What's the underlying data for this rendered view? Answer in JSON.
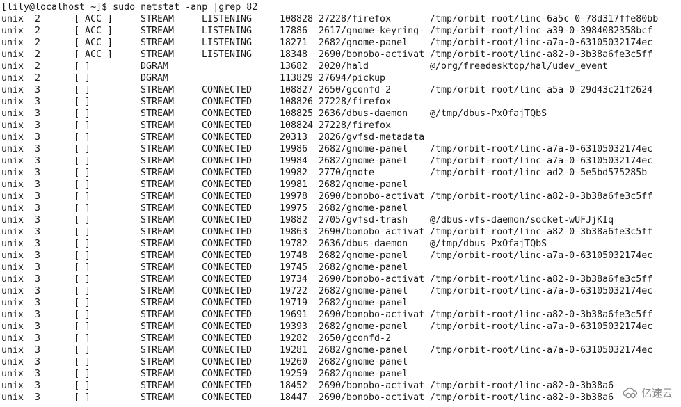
{
  "terminal": {
    "prompt": "[lily@localhost ~]$ sudo netstat -anp |grep 82",
    "rows": [
      {
        "proto": "unix",
        "refcnt": "2",
        "flags": "[ ACC ]",
        "type": "STREAM",
        "state": "LISTENING",
        "inode": "108828",
        "pid": "27228/firefox",
        "path": "/tmp/orbit-root/linc-6a5c-0-78d317ffe80bb"
      },
      {
        "proto": "unix",
        "refcnt": "2",
        "flags": "[ ACC ]",
        "type": "STREAM",
        "state": "LISTENING",
        "inode": "17886",
        "pid": "2617/gnome-keyring-",
        "path": "/tmp/orbit-root/linc-a39-0-3984082358bcf"
      },
      {
        "proto": "unix",
        "refcnt": "2",
        "flags": "[ ACC ]",
        "type": "STREAM",
        "state": "LISTENING",
        "inode": "18271",
        "pid": "2682/gnome-panel",
        "path": "/tmp/orbit-root/linc-a7a-0-63105032174ec"
      },
      {
        "proto": "unix",
        "refcnt": "2",
        "flags": "[ ACC ]",
        "type": "STREAM",
        "state": "LISTENING",
        "inode": "18348",
        "pid": "2690/bonobo-activat",
        "path": "/tmp/orbit-root/linc-a82-0-3b38a6fe3c5ff"
      },
      {
        "proto": "unix",
        "refcnt": "2",
        "flags": "[ ]",
        "type": "DGRAM",
        "state": "",
        "inode": "13682",
        "pid": "2020/hald",
        "path": "@/org/freedesktop/hal/udev_event"
      },
      {
        "proto": "unix",
        "refcnt": "2",
        "flags": "[ ]",
        "type": "DGRAM",
        "state": "",
        "inode": "113829",
        "pid": "27694/pickup",
        "path": ""
      },
      {
        "proto": "unix",
        "refcnt": "3",
        "flags": "[ ]",
        "type": "STREAM",
        "state": "CONNECTED",
        "inode": "108827",
        "pid": "2650/gconfd-2",
        "path": "/tmp/orbit-root/linc-a5a-0-29d43c21f2624"
      },
      {
        "proto": "unix",
        "refcnt": "3",
        "flags": "[ ]",
        "type": "STREAM",
        "state": "CONNECTED",
        "inode": "108826",
        "pid": "27228/firefox",
        "path": ""
      },
      {
        "proto": "unix",
        "refcnt": "3",
        "flags": "[ ]",
        "type": "STREAM",
        "state": "CONNECTED",
        "inode": "108825",
        "pid": "2636/dbus-daemon",
        "path": "@/tmp/dbus-PxOfajTQbS"
      },
      {
        "proto": "unix",
        "refcnt": "3",
        "flags": "[ ]",
        "type": "STREAM",
        "state": "CONNECTED",
        "inode": "108824",
        "pid": "27228/firefox",
        "path": ""
      },
      {
        "proto": "unix",
        "refcnt": "3",
        "flags": "[ ]",
        "type": "STREAM",
        "state": "CONNECTED",
        "inode": "20313",
        "pid": "2826/gvfsd-metadata",
        "path": ""
      },
      {
        "proto": "unix",
        "refcnt": "3",
        "flags": "[ ]",
        "type": "STREAM",
        "state": "CONNECTED",
        "inode": "19986",
        "pid": "2682/gnome-panel",
        "path": "/tmp/orbit-root/linc-a7a-0-63105032174ec"
      },
      {
        "proto": "unix",
        "refcnt": "3",
        "flags": "[ ]",
        "type": "STREAM",
        "state": "CONNECTED",
        "inode": "19984",
        "pid": "2682/gnome-panel",
        "path": "/tmp/orbit-root/linc-a7a-0-63105032174ec"
      },
      {
        "proto": "unix",
        "refcnt": "3",
        "flags": "[ ]",
        "type": "STREAM",
        "state": "CONNECTED",
        "inode": "19982",
        "pid": "2770/gnote",
        "path": "/tmp/orbit-root/linc-ad2-0-5e5bd575285b"
      },
      {
        "proto": "unix",
        "refcnt": "3",
        "flags": "[ ]",
        "type": "STREAM",
        "state": "CONNECTED",
        "inode": "19981",
        "pid": "2682/gnome-panel",
        "path": ""
      },
      {
        "proto": "unix",
        "refcnt": "3",
        "flags": "[ ]",
        "type": "STREAM",
        "state": "CONNECTED",
        "inode": "19978",
        "pid": "2690/bonobo-activat",
        "path": "/tmp/orbit-root/linc-a82-0-3b38a6fe3c5ff"
      },
      {
        "proto": "unix",
        "refcnt": "3",
        "flags": "[ ]",
        "type": "STREAM",
        "state": "CONNECTED",
        "inode": "19975",
        "pid": "2682/gnome-panel",
        "path": ""
      },
      {
        "proto": "unix",
        "refcnt": "3",
        "flags": "[ ]",
        "type": "STREAM",
        "state": "CONNECTED",
        "inode": "19882",
        "pid": "2705/gvfsd-trash",
        "path": "@/dbus-vfs-daemon/socket-wUFJjKIq"
      },
      {
        "proto": "unix",
        "refcnt": "3",
        "flags": "[ ]",
        "type": "STREAM",
        "state": "CONNECTED",
        "inode": "19863",
        "pid": "2690/bonobo-activat",
        "path": "/tmp/orbit-root/linc-a82-0-3b38a6fe3c5ff"
      },
      {
        "proto": "unix",
        "refcnt": "3",
        "flags": "[ ]",
        "type": "STREAM",
        "state": "CONNECTED",
        "inode": "19782",
        "pid": "2636/dbus-daemon",
        "path": "@/tmp/dbus-PxOfajTQbS"
      },
      {
        "proto": "unix",
        "refcnt": "3",
        "flags": "[ ]",
        "type": "STREAM",
        "state": "CONNECTED",
        "inode": "19748",
        "pid": "2682/gnome-panel",
        "path": "/tmp/orbit-root/linc-a7a-0-63105032174ec"
      },
      {
        "proto": "unix",
        "refcnt": "3",
        "flags": "[ ]",
        "type": "STREAM",
        "state": "CONNECTED",
        "inode": "19745",
        "pid": "2682/gnome-panel",
        "path": ""
      },
      {
        "proto": "unix",
        "refcnt": "3",
        "flags": "[ ]",
        "type": "STREAM",
        "state": "CONNECTED",
        "inode": "19734",
        "pid": "2690/bonobo-activat",
        "path": "/tmp/orbit-root/linc-a82-0-3b38a6fe3c5ff"
      },
      {
        "proto": "unix",
        "refcnt": "3",
        "flags": "[ ]",
        "type": "STREAM",
        "state": "CONNECTED",
        "inode": "19722",
        "pid": "2682/gnome-panel",
        "path": "/tmp/orbit-root/linc-a7a-0-63105032174ec"
      },
      {
        "proto": "unix",
        "refcnt": "3",
        "flags": "[ ]",
        "type": "STREAM",
        "state": "CONNECTED",
        "inode": "19719",
        "pid": "2682/gnome-panel",
        "path": ""
      },
      {
        "proto": "unix",
        "refcnt": "3",
        "flags": "[ ]",
        "type": "STREAM",
        "state": "CONNECTED",
        "inode": "19691",
        "pid": "2690/bonobo-activat",
        "path": "/tmp/orbit-root/linc-a82-0-3b38a6fe3c5ff"
      },
      {
        "proto": "unix",
        "refcnt": "3",
        "flags": "[ ]",
        "type": "STREAM",
        "state": "CONNECTED",
        "inode": "19393",
        "pid": "2682/gnome-panel",
        "path": "/tmp/orbit-root/linc-a7a-0-63105032174ec"
      },
      {
        "proto": "unix",
        "refcnt": "3",
        "flags": "[ ]",
        "type": "STREAM",
        "state": "CONNECTED",
        "inode": "19282",
        "pid": "2650/gconfd-2",
        "path": ""
      },
      {
        "proto": "unix",
        "refcnt": "3",
        "flags": "[ ]",
        "type": "STREAM",
        "state": "CONNECTED",
        "inode": "19281",
        "pid": "2682/gnome-panel",
        "path": "/tmp/orbit-root/linc-a7a-0-63105032174ec"
      },
      {
        "proto": "unix",
        "refcnt": "3",
        "flags": "[ ]",
        "type": "STREAM",
        "state": "CONNECTED",
        "inode": "19260",
        "pid": "2682/gnome-panel",
        "path": ""
      },
      {
        "proto": "unix",
        "refcnt": "3",
        "flags": "[ ]",
        "type": "STREAM",
        "state": "CONNECTED",
        "inode": "19259",
        "pid": "2682/gnome-panel",
        "path": ""
      },
      {
        "proto": "unix",
        "refcnt": "3",
        "flags": "[ ]",
        "type": "STREAM",
        "state": "CONNECTED",
        "inode": "18452",
        "pid": "2690/bonobo-activat",
        "path": "/tmp/orbit-root/linc-a82-0-3b38a6"
      },
      {
        "proto": "unix",
        "refcnt": "3",
        "flags": "[ ]",
        "type": "STREAM",
        "state": "CONNECTED",
        "inode": "18447",
        "pid": "2690/bonobo-activat",
        "path": "/tmp/orbit-root/linc-a82-0-3b38a6"
      }
    ]
  },
  "watermark": {
    "icon": "cloud-logo-icon",
    "text": "亿速云"
  }
}
